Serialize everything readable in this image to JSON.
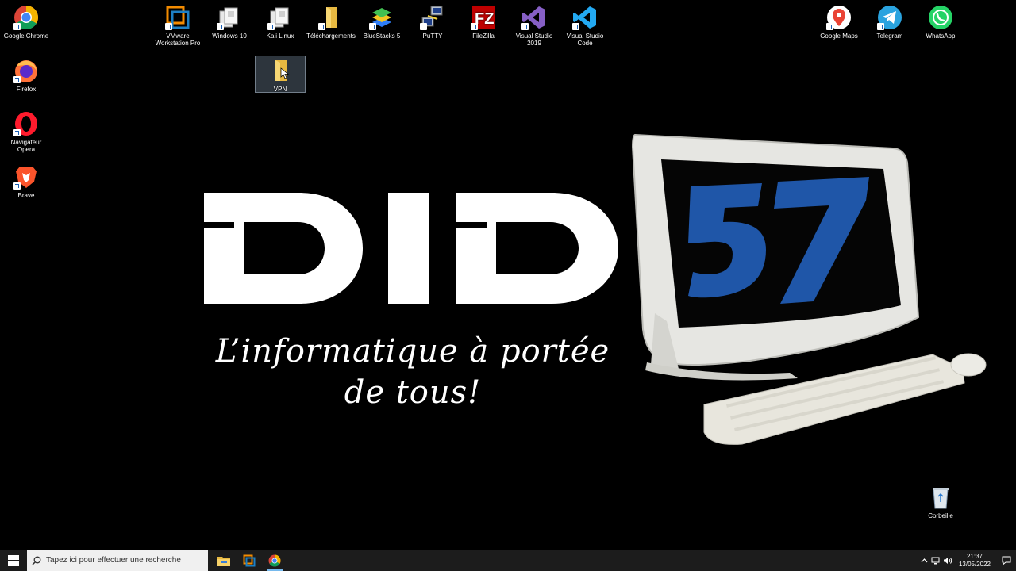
{
  "desktop": {
    "icons": [
      {
        "id": "chrome",
        "label": "Google Chrome"
      },
      {
        "id": "firefox",
        "label": "Firefox"
      },
      {
        "id": "opera",
        "label": "Navigateur Opera"
      },
      {
        "id": "brave",
        "label": "Brave"
      },
      {
        "id": "vmware",
        "label": "VMware Workstation Pro"
      },
      {
        "id": "windows10",
        "label": "Windows 10"
      },
      {
        "id": "kali",
        "label": "Kali Linux"
      },
      {
        "id": "downloads",
        "label": "Téléchargements"
      },
      {
        "id": "bluestacks",
        "label": "BlueStacks 5"
      },
      {
        "id": "putty",
        "label": "PuTTY"
      },
      {
        "id": "filezilla",
        "label": "FileZilla"
      },
      {
        "id": "vs2019",
        "label": "Visual Studio 2019"
      },
      {
        "id": "vscode",
        "label": "Visual Studio Code"
      },
      {
        "id": "vpn",
        "label": "VPN"
      },
      {
        "id": "maps",
        "label": "Google Maps"
      },
      {
        "id": "telegram",
        "label": "Telegram"
      },
      {
        "id": "whatsapp",
        "label": "WhatsApp"
      },
      {
        "id": "recycle",
        "label": "Corbeille"
      }
    ]
  },
  "wallpaper": {
    "logo": "DID",
    "logo_number": "57",
    "tagline_line1": "L’informatique à portée",
    "tagline_line2": "de tous!",
    "colors": {
      "logo": "#ffffff",
      "number": "#1f56a8"
    }
  },
  "taskbar": {
    "search_placeholder": "Tapez ici pour effectuer une recherche",
    "pinned": [
      "file-explorer",
      "vmware",
      "chrome"
    ],
    "time": "21:37",
    "date": "13/05/2022",
    "accent": "#76b9ed"
  }
}
